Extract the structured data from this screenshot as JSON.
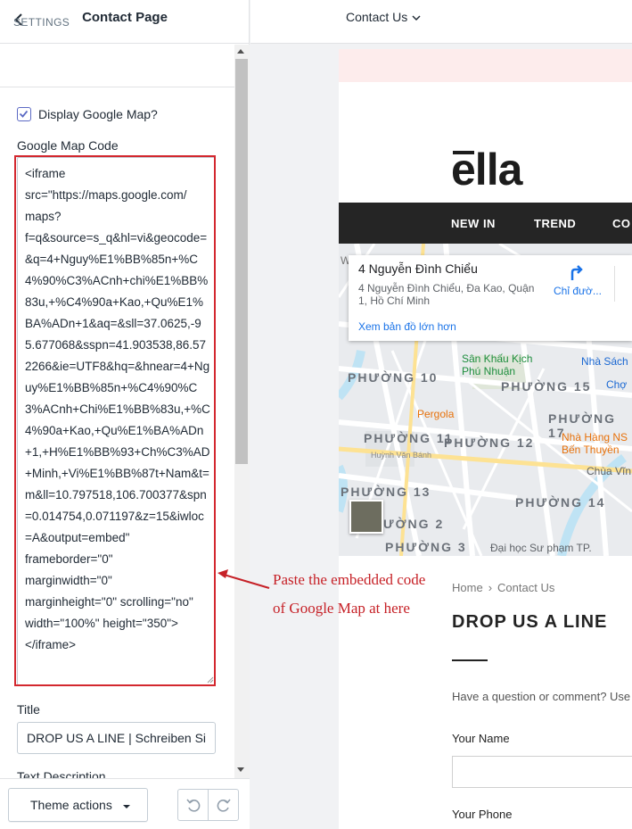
{
  "left_panel": {
    "title": "Contact Page",
    "section": "SETTINGS",
    "display_map": {
      "label": "Display Google Map?",
      "checked": true
    },
    "map_code": {
      "label": "Google Map Code",
      "value": "<iframe\nsrc=\"https://maps.google.com/\nmaps?\nf=q&source=s_q&hl=vi&geocode=&q=4+Nguy%E1%BB%85n+%C4%90%C3%ACnh+chi%E1%BB%83u,+%C4%90a+Kao,+Qu%E1%BA%ADn+1&aq=&sll=37.0625,-95.677068&sspn=41.903538,86.572266&ie=UTF8&hq=&hnear=4+Nguy%E1%BB%85n+%C4%90%C3%ACnh+Chi%E1%BB%83u,+%C4%90a+Kao,+Qu%E1%BA%ADn+1,+H%E1%BB%93+Ch%C3%AD+Minh,+Vi%E1%BB%87t+Nam&t=m&ll=10.797518,106.700377&spn=0.014754,0.071197&z=15&iwloc=A&output=embed\"\nframeborder=\"0\"\nmarginwidth=\"0\"\nmarginheight=\"0\" scrolling=\"no\"\nwidth=\"100%\" height=\"350\">\n</iframe>"
    },
    "title_field": {
      "label": "Title",
      "value": "DROP US A LINE | Schreiben Sie"
    },
    "text_description_label": "Text Description",
    "theme_actions_label": "Theme actions"
  },
  "topbar": {
    "page_select": "Contact Us"
  },
  "preview": {
    "logo": "ella",
    "nav": [
      "NEW IN",
      "TREND",
      "CO"
    ],
    "map": {
      "place_name": "4 Nguyễn Đình Chiểu",
      "place_address": "4 Nguyễn Đình Chiểu, Đa Kao, Quận 1, Hồ Chí Minh",
      "directions": "Chỉ đườ...",
      "larger_map": "Xem bản đồ lớn hơn",
      "areas": [
        "PHƯỜNG 10",
        "PHƯỜNG 15",
        "PHƯỜNG 17",
        "PHƯỜNG 11",
        "PHƯỜNG 12",
        "PHƯỜNG 13",
        "PHƯỜNG 14",
        "ƯỜNG 2",
        "PHƯỜNG 3"
      ],
      "pois": [
        "Sân Khấu Kịch",
        "Phú Nhuận",
        "Nhà Sách",
        "Chợ",
        "Pergola",
        "Nhà Hàng NS",
        "Bến Thuyền",
        "Huỳnh Văn Bánh",
        "Chùa Vĩn",
        "Đại học Sư phạm TP."
      ],
      "corner_label": "Wi"
    },
    "breadcrumb": {
      "home": "Home",
      "sep": "›",
      "current": "Contact Us"
    },
    "heading": "DROP US A LINE",
    "question": "Have a question or comment? Use",
    "name_label": "Your Name",
    "phone_label": "Your Phone"
  },
  "annotation": {
    "line1": "Paste the embedded code",
    "line2": "of Google Map at here"
  },
  "colors": {
    "highlight": "#d3282f",
    "annotation": "#c62127",
    "checkbox": "#5c6ac4",
    "nav_bg": "#252525"
  }
}
